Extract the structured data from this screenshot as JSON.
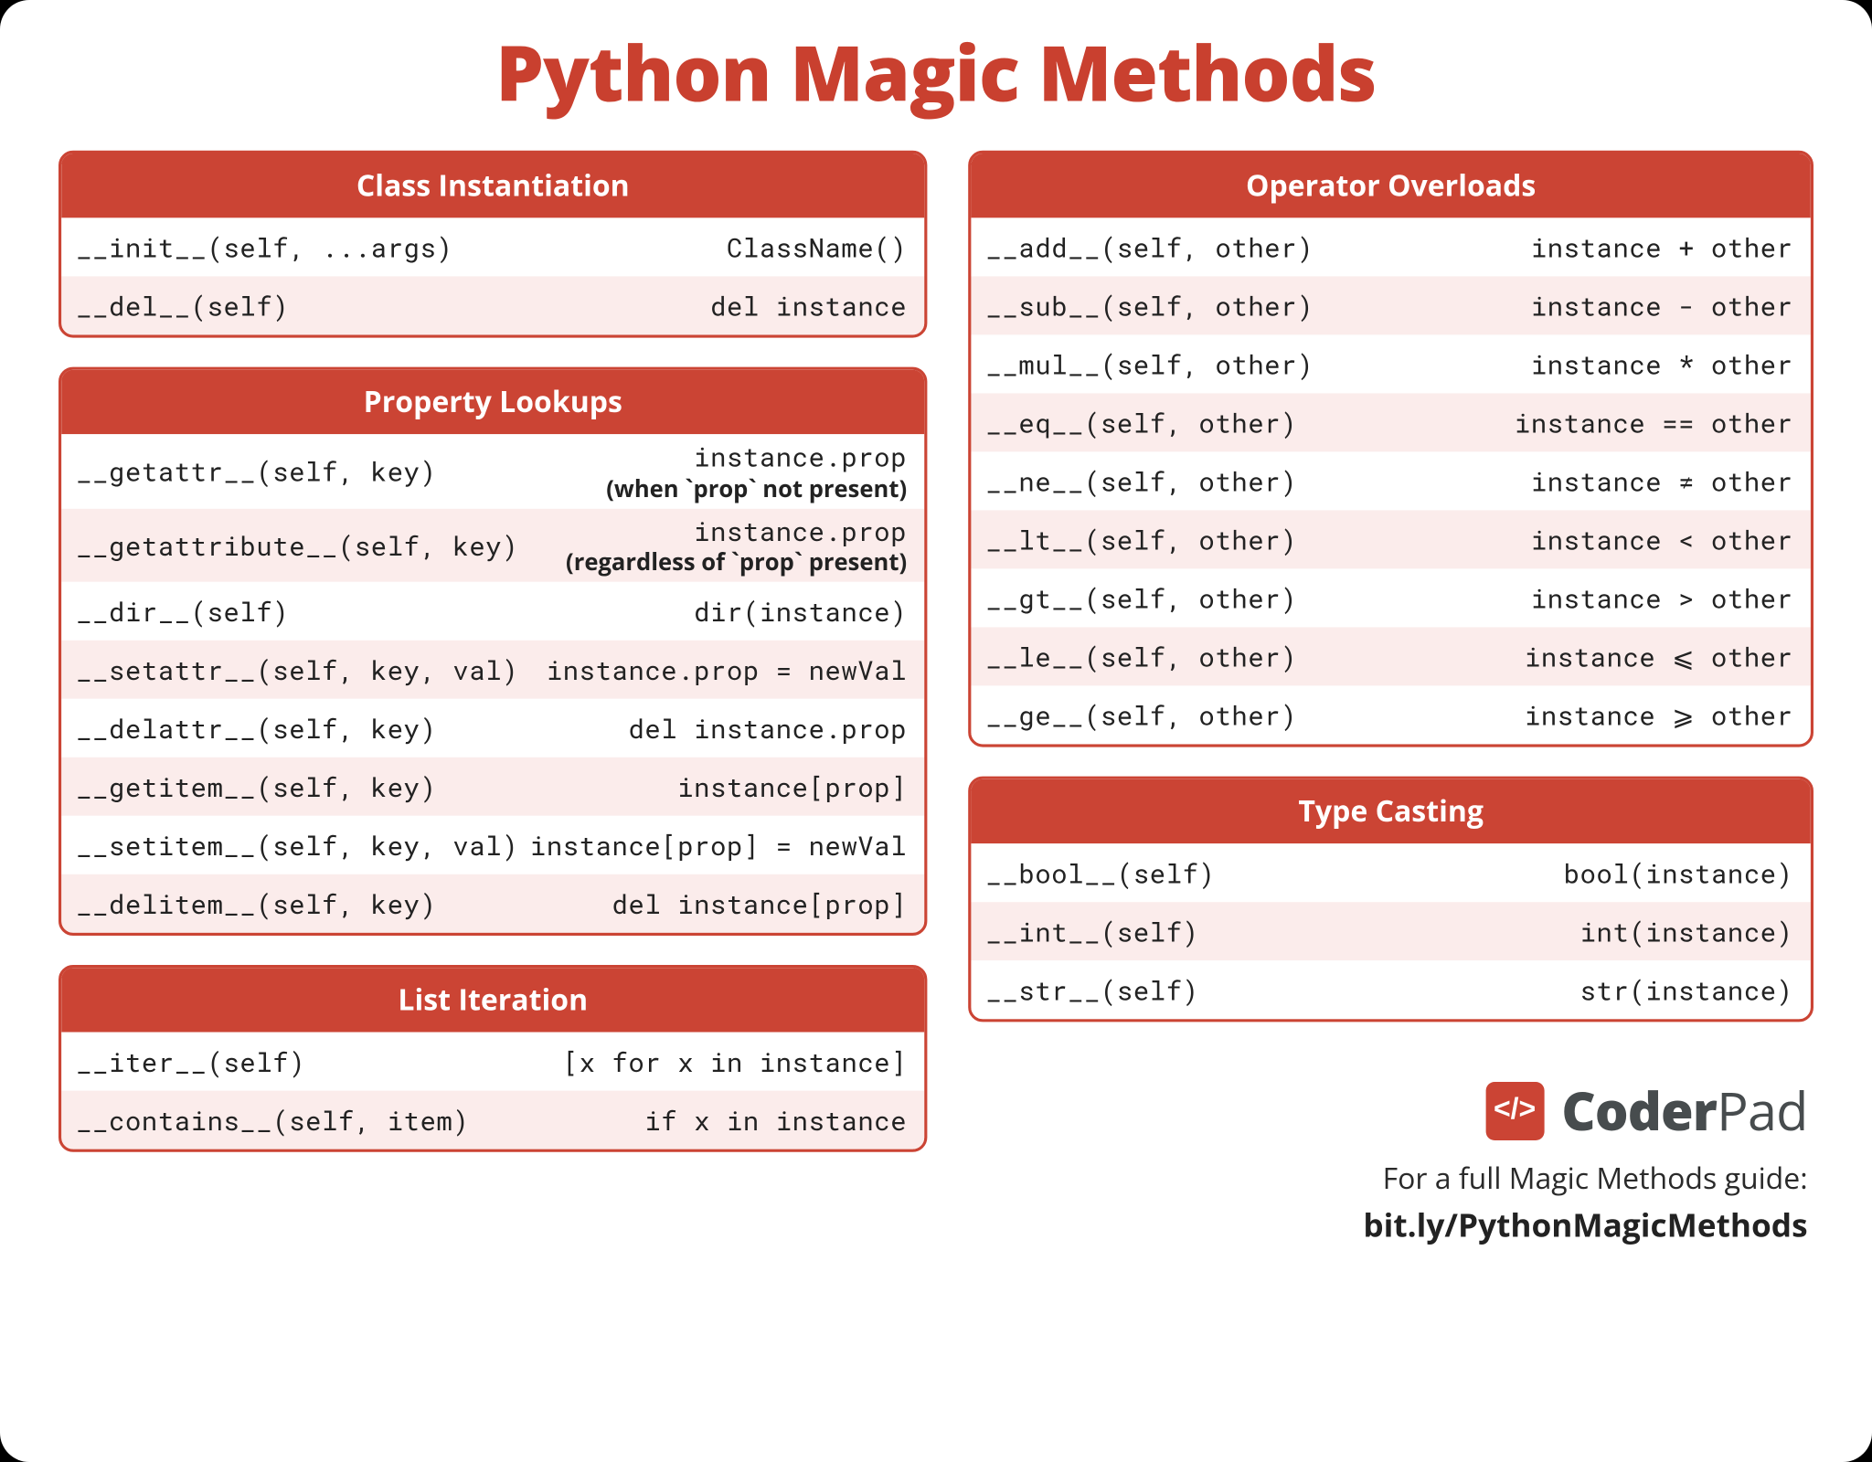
{
  "title": "Python Magic Methods",
  "colors": {
    "brand": "#c9402f",
    "brand_light": "#fbeceb",
    "charcoal": "#474c4e"
  },
  "sections": {
    "class_instantiation": {
      "heading": "Class Instantiation",
      "rows": [
        {
          "left": "__init__(self, ...args)",
          "right": "ClassName()"
        },
        {
          "left": "__del__(self)",
          "right": "del instance"
        }
      ]
    },
    "property_lookups": {
      "heading": "Property Lookups",
      "rows": [
        {
          "left": "__getattr__(self, key)",
          "right": "instance.prop",
          "sub": "(when `prop` not present)"
        },
        {
          "left": "__getattribute__(self, key)",
          "right": "instance.prop",
          "sub": "(regardless of `prop` present)"
        },
        {
          "left": "__dir__(self)",
          "right": "dir(instance)"
        },
        {
          "left": "__setattr__(self, key, val)",
          "right": "instance.prop = newVal"
        },
        {
          "left": "__delattr__(self, key)",
          "right": "del instance.prop"
        },
        {
          "left": "__getitem__(self, key)",
          "right": "instance[prop]"
        },
        {
          "left": "__setitem__(self, key, val)",
          "right": "instance[prop] = newVal"
        },
        {
          "left": "__delitem__(self, key)",
          "right": "del instance[prop]"
        }
      ]
    },
    "list_iteration": {
      "heading": "List Iteration",
      "rows": [
        {
          "left": "__iter__(self)",
          "right": "[x for x in instance]"
        },
        {
          "left": "__contains__(self, item)",
          "right": "if x in instance"
        }
      ]
    },
    "operator_overloads": {
      "heading": "Operator Overloads",
      "rows": [
        {
          "left": "__add__(self, other)",
          "right": "instance + other"
        },
        {
          "left": "__sub__(self, other)",
          "right": "instance - other"
        },
        {
          "left": "__mul__(self, other)",
          "right": "instance * other"
        },
        {
          "left": "__eq__(self, other)",
          "right": "instance == other"
        },
        {
          "left": "__ne__(self, other)",
          "right": "instance ≠ other"
        },
        {
          "left": "__lt__(self, other)",
          "right": "instance < other"
        },
        {
          "left": "__gt__(self, other)",
          "right": "instance > other"
        },
        {
          "left": "__le__(self, other)",
          "right": "instance ⩽ other"
        },
        {
          "left": "__ge__(self, other)",
          "right": "instance ⩾ other"
        }
      ]
    },
    "type_casting": {
      "heading": "Type Casting",
      "rows": [
        {
          "left": "__bool__(self)",
          "right": "bool(instance)"
        },
        {
          "left": "__int__(self)",
          "right": "int(instance)"
        },
        {
          "left": "__str__(self)",
          "right": "str(instance)"
        }
      ]
    }
  },
  "brand": {
    "icon_text": "</>",
    "name_bold": "Coder",
    "name_rest": "Pad"
  },
  "footer": {
    "line1": "For a full Magic Methods guide:",
    "link": "bit.ly/PythonMagicMethods"
  }
}
